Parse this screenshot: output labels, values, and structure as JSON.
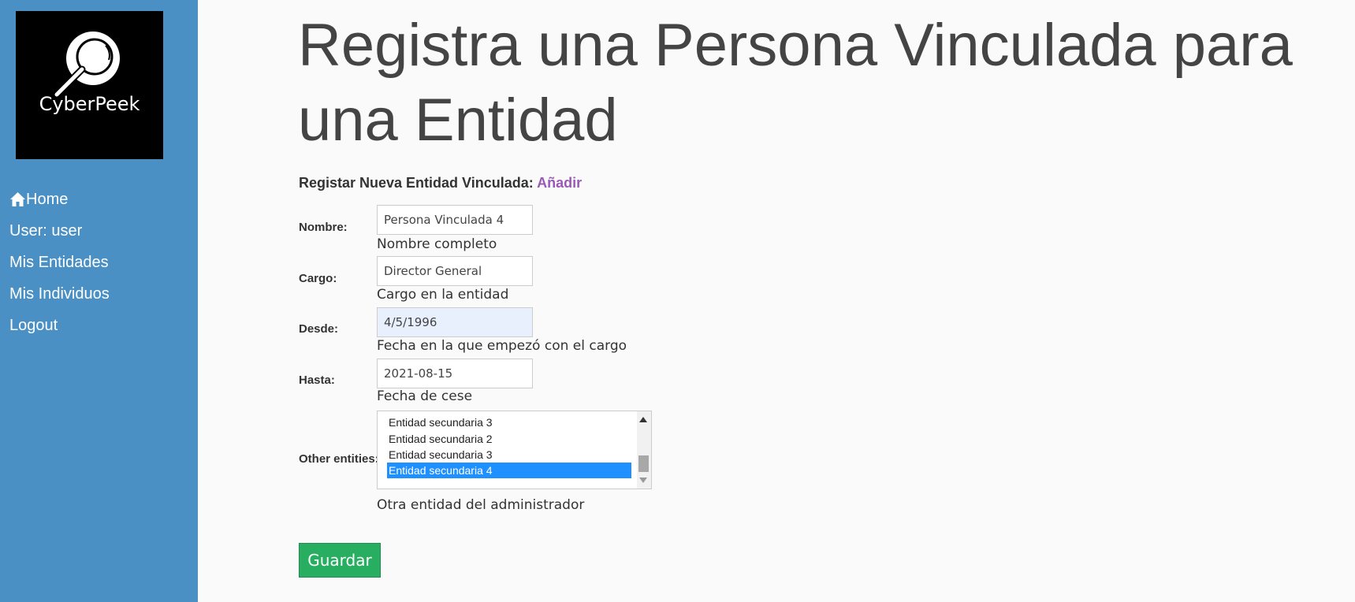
{
  "brand": {
    "logo_text": "CyberPeek"
  },
  "sidebar": {
    "items": [
      {
        "label": "Home",
        "icon": "home-icon"
      },
      {
        "label": "User: user"
      },
      {
        "label": "Mis Entidades"
      },
      {
        "label": "Mis Individuos"
      },
      {
        "label": "Logout"
      }
    ]
  },
  "page": {
    "title": "Registra una Persona Vinculada para una Entidad",
    "subhead_label": "Registar Nueva Entidad Vinculada:",
    "subhead_link": "Añadir"
  },
  "form": {
    "nombre": {
      "label": "Nombre:",
      "value": "Persona Vinculada 4",
      "hint": "Nombre completo"
    },
    "cargo": {
      "label": "Cargo:",
      "value": "Director General",
      "hint": "Cargo en la entidad"
    },
    "desde": {
      "label": "Desde:",
      "value": "4/5/1996",
      "hint": "Fecha en la que empezó con el cargo"
    },
    "hasta": {
      "label": "Hasta:",
      "value": "2021-08-15",
      "hint": "Fecha de cese"
    },
    "other_entities": {
      "label": "Other entities:",
      "options": [
        "Entidad secundaria 3",
        "Entidad secundaria 2",
        "Entidad secundaria 3",
        "Entidad secundaria 4"
      ],
      "selected": "Entidad secundaria 4",
      "hint": "Otra entidad del administrador"
    },
    "save_label": "Guardar"
  },
  "colors": {
    "sidebar": "#4a90c4",
    "link": "#9b59b6",
    "save_button": "#27ae60",
    "selected_option": "#1e90ff"
  }
}
